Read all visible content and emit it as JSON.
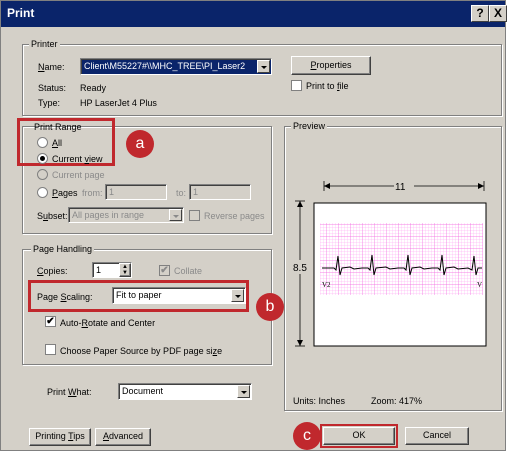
{
  "window": {
    "title": "Print",
    "help_glyph": "?",
    "close_glyph": "X"
  },
  "printer": {
    "legend": "Printer",
    "name_label": "Name:",
    "name_value": "Client\\M55227#\\\\MHC_TREE\\PI_Laser2",
    "properties_label": "Properties",
    "print_to_file_label": "Print to file",
    "status_label": "Status:",
    "status_value": "Ready",
    "type_label": "Type:",
    "type_value": "HP LaserJet 4 Plus"
  },
  "print_range": {
    "legend": "Print Range",
    "all_label": "All",
    "current_view_label": "Current view",
    "current_page_label": "Current page",
    "pages_label": "Pages",
    "from_label": "from:",
    "from_value": "1",
    "to_label": "to:",
    "to_value": "1",
    "subset_label": "Subset:",
    "subset_value": "All pages in range",
    "reverse_label": "Reverse pages"
  },
  "page_handling": {
    "legend": "Page Handling",
    "copies_label": "Copies:",
    "copies_value": "1",
    "collate_label": "Collate",
    "scaling_label": "Page Scaling:",
    "scaling_value": "Fit to paper",
    "auto_rotate_label": "Auto-Rotate and Center",
    "paper_source_label": "Choose Paper Source by PDF page size"
  },
  "print_what": {
    "label": "Print What:",
    "value": "Document"
  },
  "preview": {
    "legend": "Preview",
    "width_label": "11",
    "height_label": "8.5",
    "lead_left": "V2",
    "lead_right": "V",
    "units": "Units: Inches",
    "zoom": "Zoom: 417%"
  },
  "buttons": {
    "tips": "Printing Tips",
    "advanced": "Advanced",
    "ok": "OK",
    "cancel": "Cancel"
  },
  "callouts": {
    "a": "a",
    "b": "b",
    "c": "c"
  },
  "colors": {
    "titlebar": "#0a246a",
    "dialog": "#d4d0c8",
    "highlight": "#c0282d",
    "grid": "#ff9ef2"
  }
}
